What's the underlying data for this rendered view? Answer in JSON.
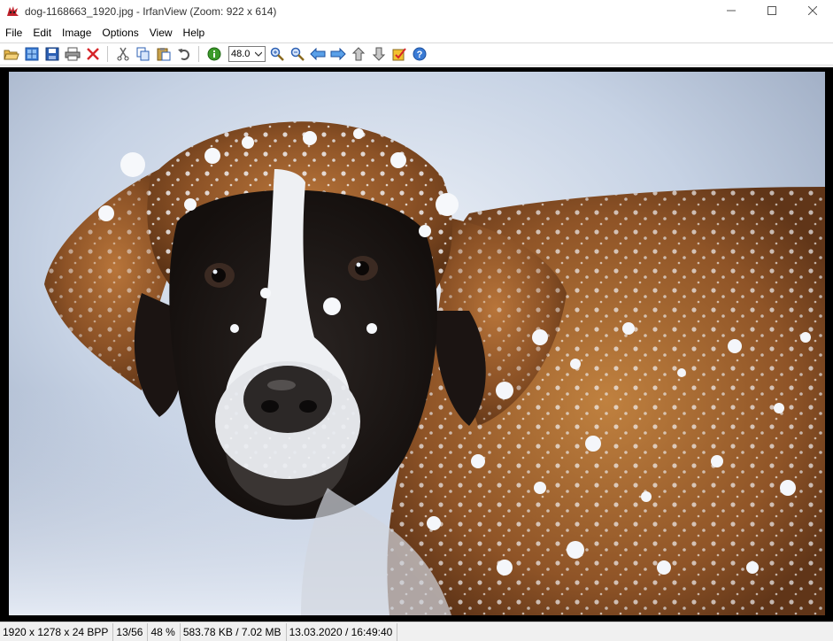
{
  "window": {
    "title": "dog-1168663_1920.jpg - IrfanView (Zoom: 922 x 614)",
    "app_icon": "irfanview-cat-icon",
    "controls": {
      "minimize_icon": "minimize-icon",
      "maximize_icon": "maximize-icon",
      "close_icon": "close-icon"
    }
  },
  "menu": {
    "items": [
      {
        "label": "File"
      },
      {
        "label": "Edit"
      },
      {
        "label": "Image"
      },
      {
        "label": "Options"
      },
      {
        "label": "View"
      },
      {
        "label": "Help"
      }
    ]
  },
  "toolbar": {
    "zoom_value": "48.0",
    "buttons": [
      "open-folder-icon",
      "thumbnails-icon",
      "save-icon",
      "print-icon",
      "delete-icon",
      "cut-icon",
      "copy-icon",
      "paste-icon",
      "undo-icon",
      "info-icon",
      "zoom-in-icon",
      "zoom-out-icon",
      "previous-icon",
      "next-icon",
      "previous-dir-icon",
      "next-dir-icon",
      "properties-icon",
      "help-icon"
    ]
  },
  "image": {
    "description_icon": "dog-photo"
  },
  "status": {
    "dimensions": "1920 x 1278 x 24 BPP",
    "index": "13/56",
    "zoom": "48 %",
    "size": "583.78 KB / 7.02 MB",
    "datetime": "13.03.2020 / 16:49:40"
  },
  "colors": {
    "viewport_bg": "#000000",
    "status_bg": "#f0f0f0"
  }
}
